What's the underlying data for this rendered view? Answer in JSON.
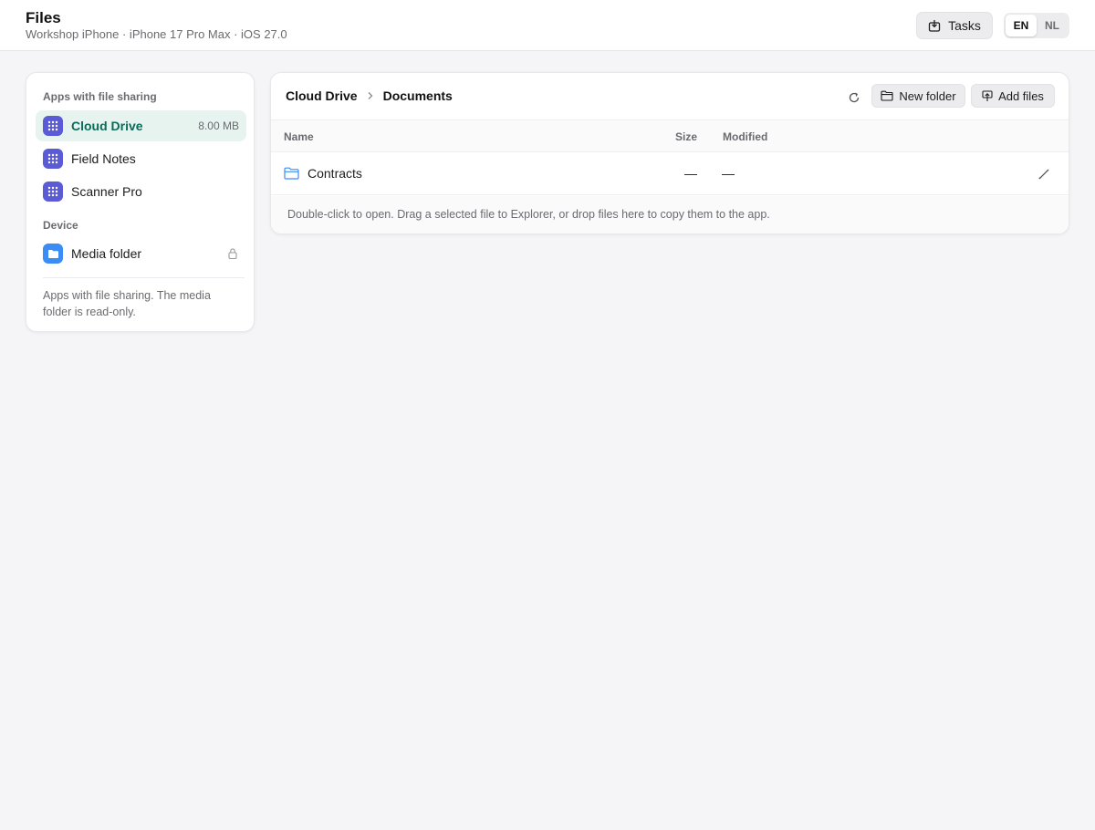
{
  "header": {
    "title": "Files",
    "subtitle": "Workshop iPhone · iPhone 17 Pro Max · iOS 27.0",
    "tasks_label": "Tasks",
    "languages": [
      "EN",
      "NL"
    ],
    "active_language": "EN"
  },
  "sidebar": {
    "apps_section": "Apps with file sharing",
    "apps": [
      {
        "label": "Cloud Drive",
        "size": "8.00 MB",
        "icon": "app-grid-icon",
        "selected": true
      },
      {
        "label": "Field Notes",
        "icon": "app-grid-icon"
      },
      {
        "label": "Scanner Pro",
        "icon": "app-grid-icon"
      }
    ],
    "device_section": "Device",
    "device_items": [
      {
        "label": "Media folder",
        "icon": "folder-icon",
        "locked": true
      }
    ],
    "note": "Apps with file sharing. The media folder is read-only."
  },
  "main": {
    "breadcrumb": [
      "Cloud Drive",
      "Documents"
    ],
    "new_folder_label": "New folder",
    "add_files_label": "Add files",
    "columns": {
      "name": "Name",
      "size": "Size",
      "modified": "Modified"
    },
    "rows": [
      {
        "name": "Contracts",
        "size": "—",
        "modified": "—",
        "type": "folder"
      }
    ],
    "hint": "Double-click to open. Drag a selected file to Explorer, or drop files here to copy them to the app."
  },
  "colors": {
    "accent_app_icon": "#5b5bd6",
    "selected_bg": "#e6f3ef",
    "selected_text": "#0b6b5a",
    "folder_blue": "#3a8df5"
  }
}
